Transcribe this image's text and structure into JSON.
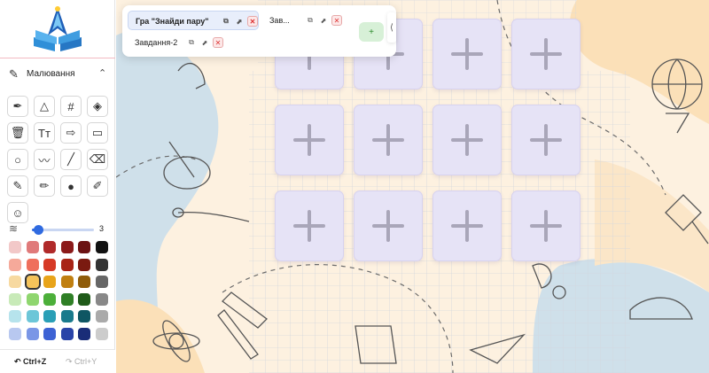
{
  "sidebar": {
    "section_title": "Малювання",
    "section_icon": "pencil-ruler-icon",
    "tools": [
      {
        "name": "pen-tool-icon",
        "glyph": "✒"
      },
      {
        "name": "triangle-tool-icon",
        "glyph": "△"
      },
      {
        "name": "grid-tool-icon",
        "glyph": "#"
      },
      {
        "name": "layers-tool-icon",
        "glyph": "◈"
      },
      {
        "name": "trash-icon",
        "glyph": "🗑"
      },
      {
        "name": "text-tool-icon",
        "glyph": "Tт"
      },
      {
        "name": "arrow-tool-icon",
        "glyph": "⇨"
      },
      {
        "name": "rectangle-tool-icon",
        "glyph": "▭"
      },
      {
        "name": "circle-tool-icon",
        "glyph": "○"
      },
      {
        "name": "polyline-tool-icon",
        "glyph": "〰"
      },
      {
        "name": "line-tool-icon",
        "glyph": "╱"
      },
      {
        "name": "eraser-tool-icon",
        "glyph": "⌫"
      },
      {
        "name": "pencil-tool-icon",
        "glyph": "✎"
      },
      {
        "name": "crayon-tool-icon",
        "glyph": "✏"
      },
      {
        "name": "color-wheel-icon",
        "glyph": "●"
      },
      {
        "name": "highlighter-tool-icon",
        "glyph": "✐"
      },
      {
        "name": "stickers-tool-icon",
        "glyph": "☺"
      }
    ],
    "stroke_width": "3",
    "stroke_width_fraction": 0.1,
    "palette": [
      [
        "#f2c8c8",
        "#e07a7a",
        "#b02a2a",
        "#8b1a1a",
        "#6b1212",
        "#111111"
      ],
      [
        "#f5a99a",
        "#ef6f5c",
        "#d63a26",
        "#a82416",
        "#7a1a10",
        "#333333"
      ],
      [
        "#f7d9a0",
        "#f5c35a",
        "#e8a41a",
        "#c07f10",
        "#8f5c0a",
        "#666666"
      ],
      [
        "#c8eab8",
        "#8fd66f",
        "#4caf3a",
        "#2f7f26",
        "#1f5a19",
        "#888888"
      ],
      [
        "#b6e3ec",
        "#6cc6d8",
        "#2a9fb6",
        "#1a7a8c",
        "#0f5663",
        "#aaaaaa"
      ],
      [
        "#b8c8f0",
        "#7a96e6",
        "#3d62d4",
        "#2a44a8",
        "#1a2d78",
        "#cccccc"
      ]
    ],
    "selected_color": "#f5c35a",
    "undo_label": "Ctrl+Z",
    "redo_label": "Ctrl+Y"
  },
  "tabs": [
    {
      "label": "Гра \"Знайди пару\"",
      "active": true
    },
    {
      "label": "Зав...",
      "active": false
    },
    {
      "label": "Завдання-2",
      "active": false
    }
  ],
  "add_tab_label": "+",
  "collapse_label": "⟨",
  "cards": {
    "rows": 3,
    "cols": 4,
    "face": "+"
  }
}
